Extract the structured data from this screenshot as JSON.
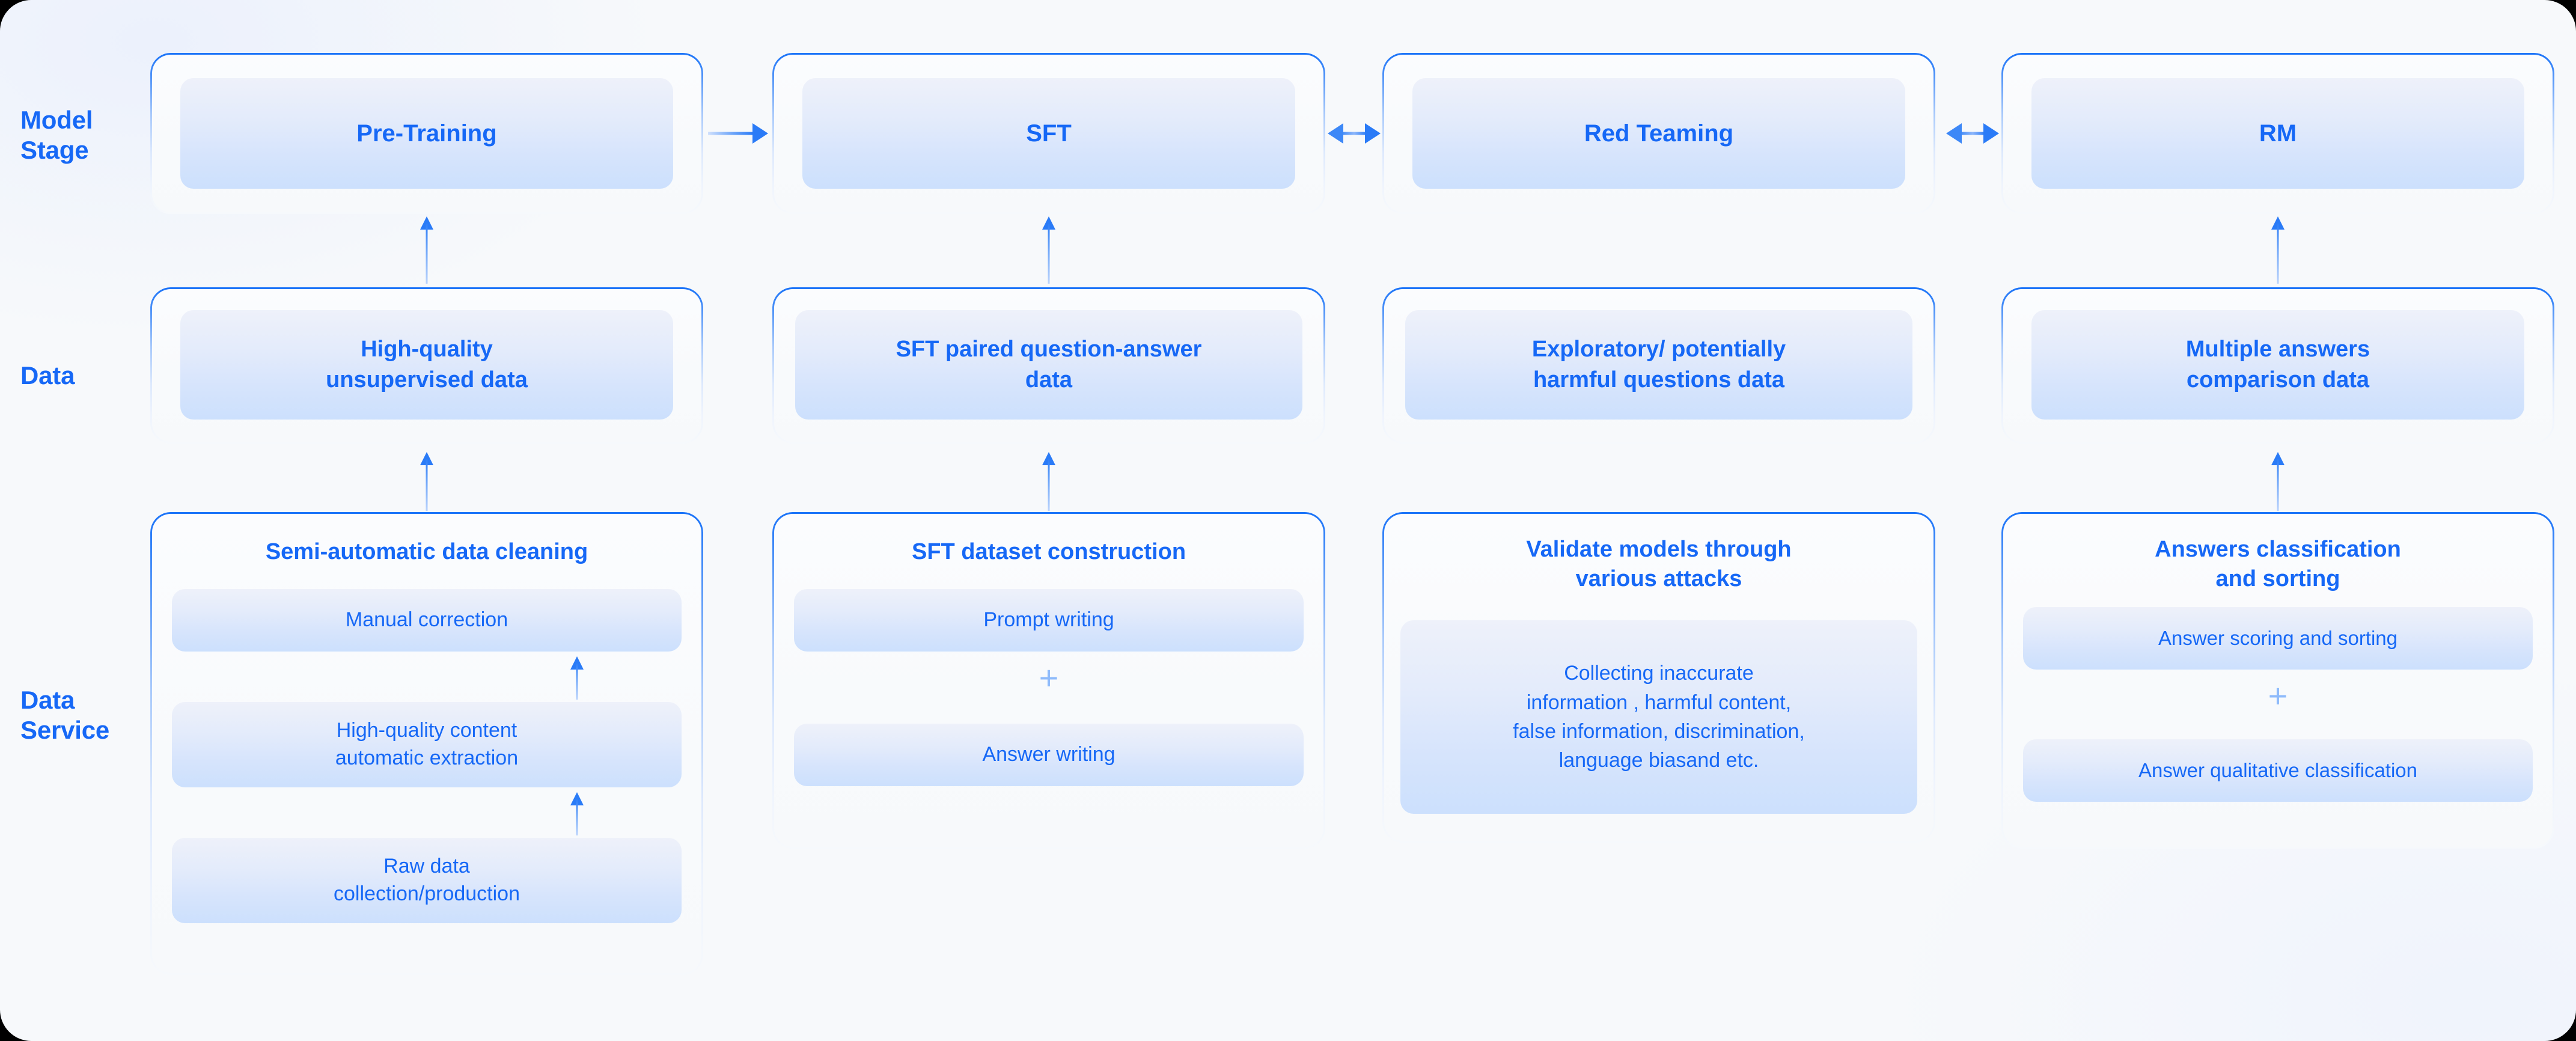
{
  "row_labels": {
    "model_stage": "Model\nStage",
    "data": "Data",
    "data_service": "Data\nService"
  },
  "colors": {
    "accent": "#1668f6",
    "arrow": "#2a7bf7",
    "chip_top": "#eef1fa",
    "chip_bottom": "#cce0fd",
    "canvas": "#f7f9fb"
  },
  "columns": [
    {
      "id": "pretraining",
      "model_stage": "Pre-Training",
      "data": "High-quality\nunsupervised data",
      "service_title": "Semi-automatic data cleaning",
      "service_items": [
        "Manual correction",
        "High-quality content\nautomatic extraction",
        "Raw data\ncollection/production"
      ],
      "service_separator": "arrow"
    },
    {
      "id": "sft",
      "model_stage": "SFT",
      "data": "SFT paired question-answer\ndata",
      "service_title": "SFT dataset construction",
      "service_items": [
        "Prompt writing",
        "Answer writing"
      ],
      "service_separator": "plus",
      "separator_symbol": "+"
    },
    {
      "id": "red-teaming",
      "model_stage": "Red Teaming",
      "data": "Exploratory/ potentially\nharmful questions data",
      "service_title": "Validate models through\nvarious attacks",
      "service_items": [
        "Collecting inaccurate\ninformation , harmful content,\nfalse information, discrimination,\nlanguage biasand etc."
      ],
      "service_separator": "none"
    },
    {
      "id": "rm",
      "model_stage": "RM",
      "data": "Multiple answers\ncomparison data",
      "service_title": "Answers classification\nand sorting",
      "service_items": [
        "Answer scoring and sorting",
        "Answer qualitative classification"
      ],
      "service_separator": "plus",
      "separator_symbol": "+"
    }
  ],
  "connectors": {
    "stage_flow": [
      {
        "from": "pretraining",
        "to": "sft",
        "type": "arrow-right"
      },
      {
        "from": "sft",
        "to": "red-teaming",
        "type": "arrow-both"
      },
      {
        "from": "red-teaming",
        "to": "rm",
        "type": "arrow-both"
      }
    ],
    "vertical_up": [
      {
        "column": "pretraining",
        "from": "data",
        "to": "model_stage"
      },
      {
        "column": "sft",
        "from": "data",
        "to": "model_stage"
      },
      {
        "column": "rm",
        "from": "data",
        "to": "model_stage"
      },
      {
        "column": "pretraining",
        "from": "data_service",
        "to": "data"
      },
      {
        "column": "sft",
        "from": "data_service",
        "to": "data"
      },
      {
        "column": "rm",
        "from": "data_service",
        "to": "data"
      }
    ]
  }
}
